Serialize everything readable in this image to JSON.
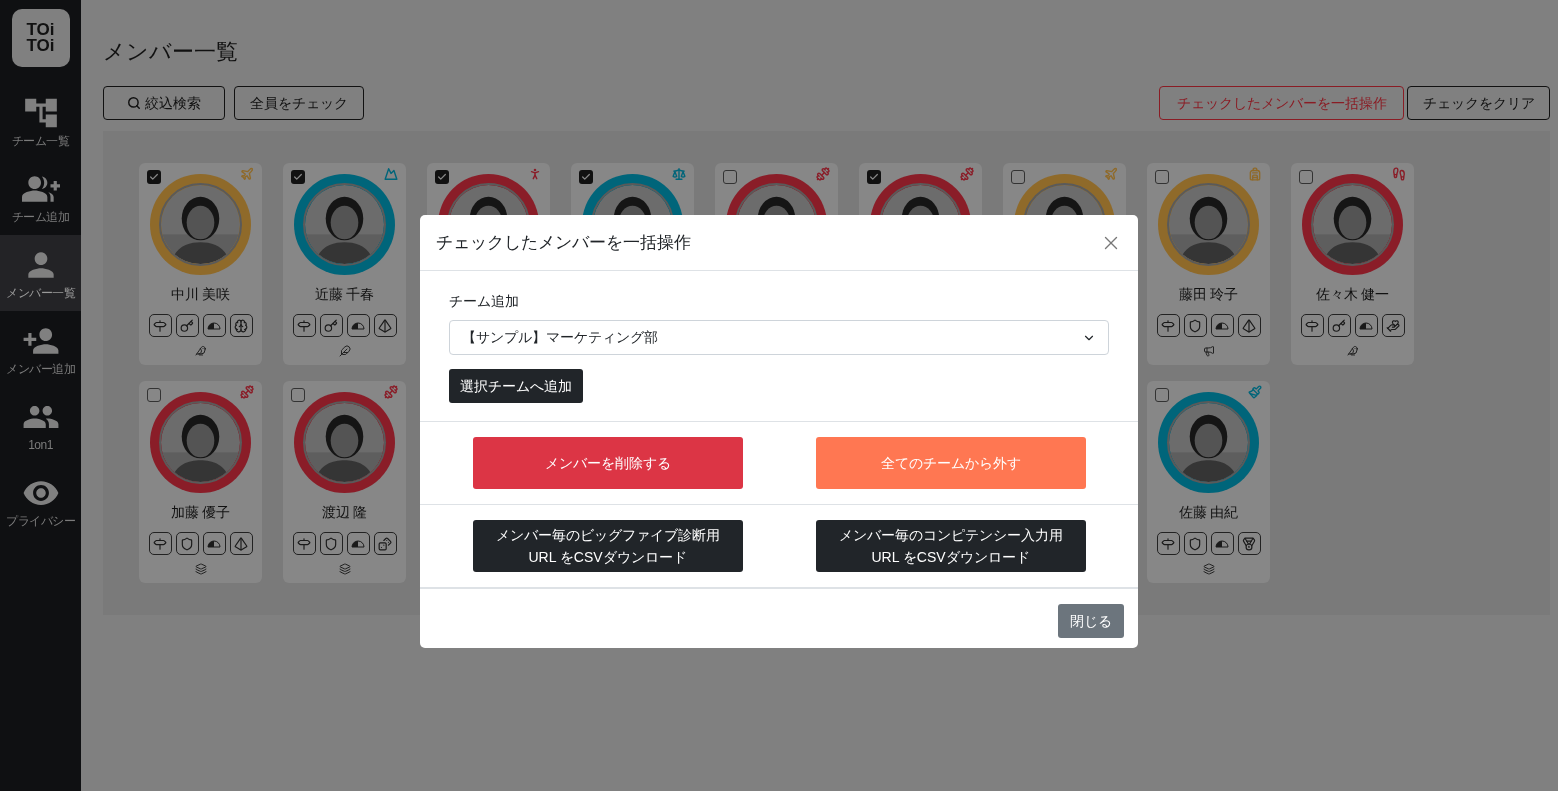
{
  "sidebar": {
    "logo": {
      "lines": [
        "TOi",
        "TOi"
      ]
    },
    "items": [
      {
        "label": "チーム一覧",
        "selected": false
      },
      {
        "label": "チーム追加",
        "selected": false
      },
      {
        "label": "メンバー一覧",
        "selected": true
      },
      {
        "label": "メンバー追加",
        "selected": false
      },
      {
        "label": "1on1",
        "selected": false
      },
      {
        "label": "プライバシー",
        "selected": false
      }
    ]
  },
  "page": {
    "title": "メンバー一覧",
    "left_buttons": [
      "絞込検索",
      "全員をチェック"
    ],
    "right_buttons": [
      {
        "label": "チェックしたメンバーを一括操作",
        "kind": "danger"
      },
      {
        "label": "チェックをクリア",
        "kind": "default"
      }
    ]
  },
  "member_rows": [
    [
      {
        "name": "中川 美咲",
        "checked": true,
        "color": "#8f6a2a",
        "sport": {
          "kind": "plane"
        },
        "badges": [
          {
            "kind": "signpost"
          },
          {
            "kind": "key"
          },
          {
            "kind": "half"
          },
          {
            "kind": "brain"
          }
        ],
        "bottom": {
          "kind": "bird"
        }
      },
      {
        "name": "近藤 千春",
        "checked": true,
        "color": "#00657a",
        "sport": {
          "kind": "climber"
        },
        "badges": [
          {
            "kind": "signpost"
          },
          {
            "kind": "key"
          },
          {
            "kind": "half"
          },
          {
            "kind": "pyramid"
          }
        ],
        "bottom": {
          "kind": "feather"
        }
      },
      {
        "checked": true,
        "color": "#8a1d28",
        "sport": {
          "kind": "figure"
        }
      },
      {
        "checked": true,
        "color": "#00657a",
        "sport": {
          "kind": "scale"
        }
      },
      {
        "checked": false,
        "color": "#8a1d28",
        "sport": {
          "kind": "lifter"
        }
      },
      {
        "checked": true,
        "color": "#8a1d28",
        "sport": {
          "kind": "lifter"
        }
      },
      {
        "checked": false,
        "color": "#8f6a2a",
        "sport": {
          "kind": "plane"
        }
      },
      {
        "name": "藤田 玲子",
        "checked": false,
        "color": "#8f6a2a",
        "sport": {
          "kind": "hiker"
        },
        "badges": [
          {
            "kind": "signpost"
          },
          {
            "kind": "shield"
          },
          {
            "kind": "half"
          },
          {
            "kind": "pyramid"
          }
        ],
        "bottom": {
          "kind": "megaphone"
        }
      },
      {
        "name": "佐々木 健一",
        "checked": false,
        "color": "#8a1d28",
        "sport": {
          "kind": "runner"
        },
        "badges": [
          {
            "kind": "signpost"
          },
          {
            "kind": "key"
          },
          {
            "kind": "half"
          },
          {
            "kind": "hand-heart"
          }
        ],
        "bottom": {
          "kind": "bird"
        }
      }
    ],
    [
      {
        "name": "加藤 優子",
        "checked": false,
        "color": "#8a1d28",
        "sport": {
          "kind": "lifter"
        },
        "badges": [
          {
            "kind": "signpost"
          },
          {
            "kind": "shield"
          },
          {
            "kind": "half"
          },
          {
            "kind": "pyramid"
          }
        ],
        "bottom": {
          "kind": "cards"
        }
      },
      {
        "name": "渡辺 隆",
        "checked": false,
        "color": "#8a1d28",
        "sport": {
          "kind": "lifter"
        },
        "badges": [
          {
            "kind": "signpost"
          },
          {
            "kind": "shield"
          },
          {
            "kind": "half"
          },
          {
            "kind": "dice"
          }
        ],
        "bottom": {
          "kind": "cards"
        }
      },
      null,
      null,
      null,
      null,
      null,
      {
        "name": "佐藤 由紀",
        "checked": false,
        "color": "#00657a",
        "sport": {
          "kind": "painter"
        },
        "badges": [
          {
            "kind": "signpost"
          },
          {
            "kind": "shield"
          },
          {
            "kind": "half"
          },
          {
            "kind": "medal"
          }
        ],
        "bottom": {
          "kind": "cards"
        }
      }
    ]
  ],
  "modal": {
    "title": "チェックしたメンバーを一括操作",
    "team_label": "チーム追加",
    "team_select": "【サンプル】マーケティング部",
    "add_button": "選択チームへ追加",
    "action_buttons": [
      {
        "label": "メンバーを削除する",
        "kind": "danger"
      },
      {
        "label": "全てのチームから外す",
        "kind": "warning"
      }
    ],
    "download_buttons": [
      {
        "lines": [
          "メンバー毎のビッグファイブ診断用",
          "URL をCSVダウンロード"
        ]
      },
      {
        "lines": [
          "メンバー毎のコンピテンシー入力用",
          "URL をCSVダウンロード"
        ]
      }
    ],
    "close_button": "閉じる"
  }
}
